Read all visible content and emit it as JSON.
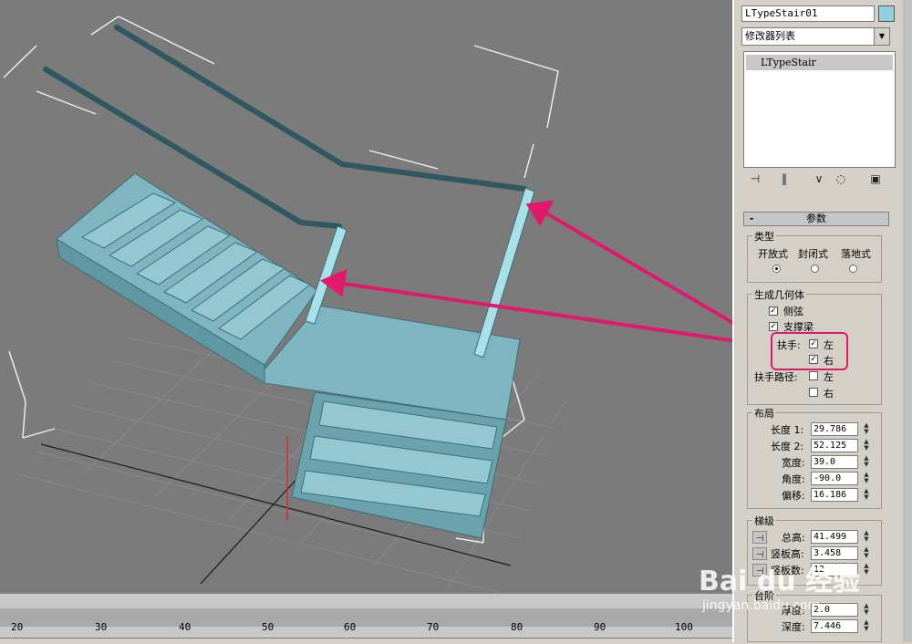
{
  "panel": {
    "object_name": "LTypeStair01",
    "object_color": "#8fd0dc",
    "modifier_list_label": "修改器列表",
    "stack_item": "LTypeStair",
    "toolbar_icons": [
      "pin-stack-icon",
      "show-end-result-icon",
      "make-unique-icon",
      "remove-modifier-icon",
      "configure-modifier-sets-icon"
    ],
    "rollout_title": "参数",
    "type_group": {
      "label": "类型",
      "options": [
        "开放式",
        "封闭式",
        "落地式"
      ],
      "selected_index": 0
    },
    "geometry_group": {
      "label": "生成几何体",
      "stringers": {
        "label": "侧弦",
        "checked": true
      },
      "carriage": {
        "label": "支撑梁",
        "checked": true
      },
      "handrail_label": "扶手:",
      "handrail_left": {
        "label": "左",
        "checked": true
      },
      "handrail_right": {
        "label": "右",
        "checked": true
      },
      "rail_path_label": "扶手路径:",
      "rail_path_left": {
        "label": "左",
        "checked": false
      },
      "rail_path_right": {
        "label": "右",
        "checked": false
      }
    },
    "layout_group": {
      "label": "布局",
      "fields": [
        {
          "label": "长度 1:",
          "value": "29.786"
        },
        {
          "label": "长度 2:",
          "value": "52.125"
        },
        {
          "label": "宽度:",
          "value": "39.0"
        },
        {
          "label": "角度:",
          "value": "-90.0"
        },
        {
          "label": "偏移:",
          "value": "16.186"
        }
      ]
    },
    "steps_group": {
      "label": "梯级",
      "fields": [
        {
          "label": "总高:",
          "value": "41.499"
        },
        {
          "label": "竖板高:",
          "value": "3.458"
        },
        {
          "label": "竖板数:",
          "value": "12"
        }
      ]
    },
    "stairs_group": {
      "label": "台阶",
      "fields": [
        {
          "label": "厚度:",
          "value": "2.0"
        },
        {
          "label": "深度:",
          "value": "7.446"
        }
      ]
    },
    "highlight_color": "#e0196e"
  },
  "timeline": {
    "ticks": [
      "20",
      "30",
      "40",
      "50",
      "60",
      "70",
      "80",
      "90",
      "100"
    ]
  },
  "watermark": {
    "brand": "Bai du 经验",
    "url": "jingyan.baidu.com"
  }
}
